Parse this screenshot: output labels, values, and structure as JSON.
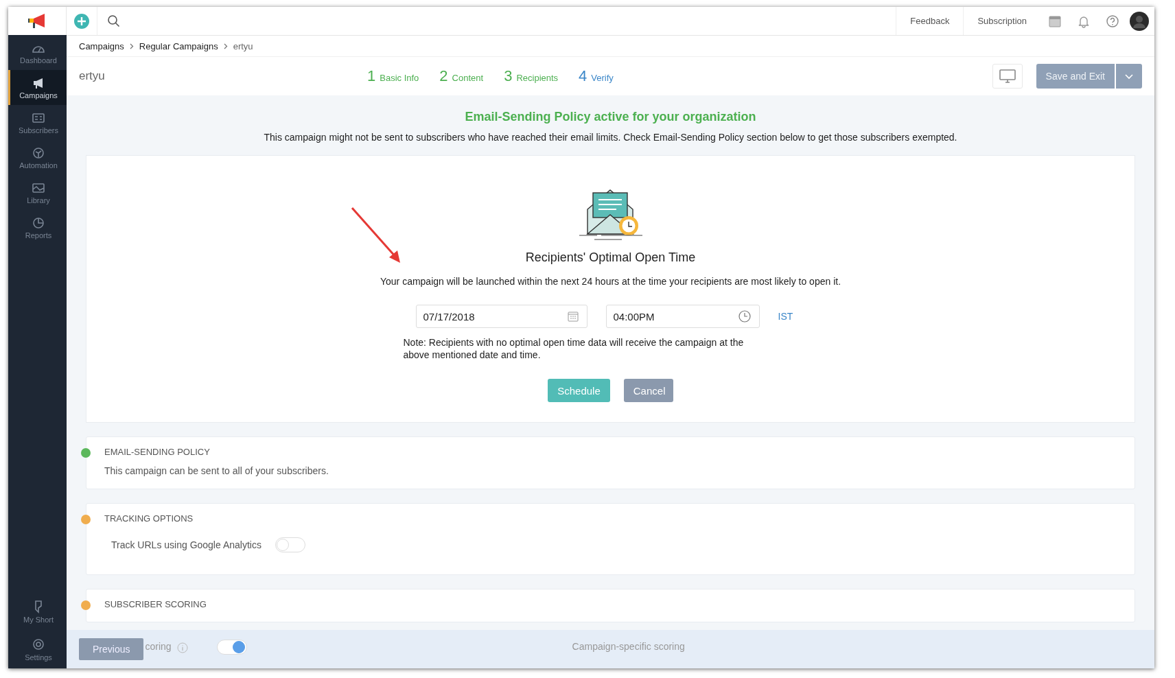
{
  "topbar": {
    "links": [
      "Feedback",
      "Subscription"
    ]
  },
  "sidebar": {
    "items": [
      {
        "label": "Dashboard",
        "kind": "dashboard",
        "selected": false
      },
      {
        "label": "Campaigns",
        "kind": "campaigns",
        "selected": true
      },
      {
        "label": "Subscribers",
        "kind": "subscribers",
        "selected": false
      },
      {
        "label": "Automation",
        "kind": "automation",
        "selected": false
      },
      {
        "label": "Library",
        "kind": "library",
        "selected": false
      },
      {
        "label": "Reports",
        "kind": "reports",
        "selected": false
      }
    ],
    "bottom_items": [
      {
        "label": "My Short",
        "kind": "short",
        "selected": false
      },
      {
        "label": "Settings",
        "kind": "settings",
        "selected": false
      }
    ]
  },
  "breadcrumb": [
    "Campaigns",
    "Regular Campaigns",
    "ertyu"
  ],
  "header": {
    "title": "ertyu",
    "save_button": "Save and Exit"
  },
  "steps": [
    {
      "number": "1",
      "label": "Basic Info",
      "selected": false
    },
    {
      "number": "2",
      "label": "Content",
      "selected": false
    },
    {
      "number": "3",
      "label": "Recipients",
      "selected": false
    },
    {
      "number": "4",
      "label": "Verify",
      "selected": true
    }
  ],
  "policy_banner": {
    "title": "Email-Sending Policy active for your organization",
    "text": "This campaign might not be sent to subscribers who have reached their email limits. Check Email-Sending Policy section below to get those subscribers exempted."
  },
  "schedule_card": {
    "title": "Recipients' Optimal Open Time",
    "description": "Your campaign will be launched within the next 24 hours at the time your recipients are most likely to open it.",
    "date": "07/17/2018",
    "time": "04:00PM",
    "timezone": "IST",
    "note": "Note: Recipients with no optimal open time data will receive the campaign at the above mentioned date and time.",
    "buttons": [
      "Schedule",
      "Cancel"
    ]
  },
  "sections": [
    {
      "title": "EMAIL-SENDING POLICY",
      "color": "#5cb85c",
      "text": "This campaign can be sent to all of your subscribers."
    },
    {
      "title": "TRACKING OPTIONS",
      "color": "#f0ad4e",
      "toggle": {
        "label": "Track URLs using Google Analytics",
        "on": false
      }
    },
    {
      "title": "SUBSCRIBER SCORING",
      "color": "#f0ad4e"
    }
  ],
  "footer": {
    "previous": "Previous",
    "scoring_label": "coring",
    "scoring_on": true,
    "campaign_scoring": "Campaign-specific scoring"
  }
}
